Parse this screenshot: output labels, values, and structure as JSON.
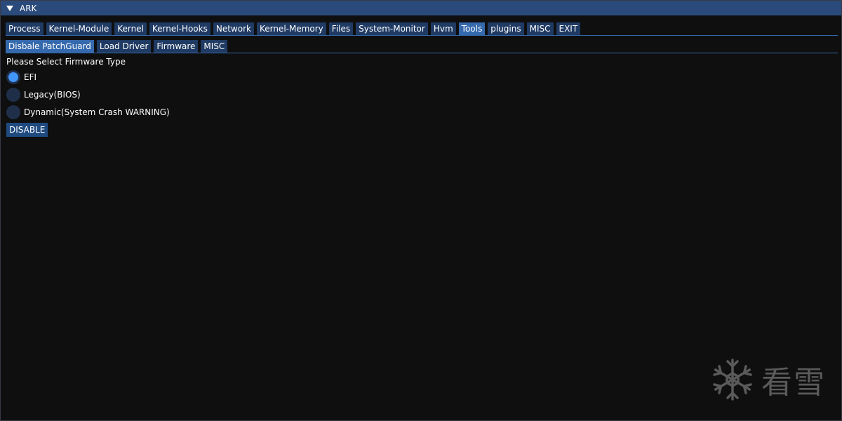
{
  "window": {
    "title": "ARK"
  },
  "main_tabs": [
    {
      "label": "Process"
    },
    {
      "label": "Kernel-Module"
    },
    {
      "label": "Kernel"
    },
    {
      "label": "Kernel-Hooks"
    },
    {
      "label": "Network"
    },
    {
      "label": "Kernel-Memory"
    },
    {
      "label": "Files"
    },
    {
      "label": "System-Monitor"
    },
    {
      "label": "Hvm"
    },
    {
      "label": "Tools"
    },
    {
      "label": "plugins"
    },
    {
      "label": "MISC"
    },
    {
      "label": "EXIT"
    }
  ],
  "main_tabs_active": "Tools",
  "sub_tabs": [
    {
      "label": "Disbale PatchGuard"
    },
    {
      "label": "Load Driver"
    },
    {
      "label": "Firmware"
    },
    {
      "label": "MISC"
    }
  ],
  "sub_tabs_active": "Disbale PatchGuard",
  "firmware": {
    "prompt": "Please Select Firmware Type",
    "options": [
      {
        "label": "EFI",
        "selected": true
      },
      {
        "label": "Legacy(BIOS)",
        "selected": false
      },
      {
        "label": "Dynamic(System Crash WARNING)",
        "selected": false
      }
    ],
    "button_label": "DISABLE"
  },
  "watermark": {
    "icon": "snowflake-icon",
    "text": "看雪"
  },
  "colors": {
    "title_bar": "#294a7a",
    "tab": "#1f3a63",
    "tab_active": "#3569ad",
    "radio_selected": "#4296fa",
    "background": "#0f0f0f"
  }
}
